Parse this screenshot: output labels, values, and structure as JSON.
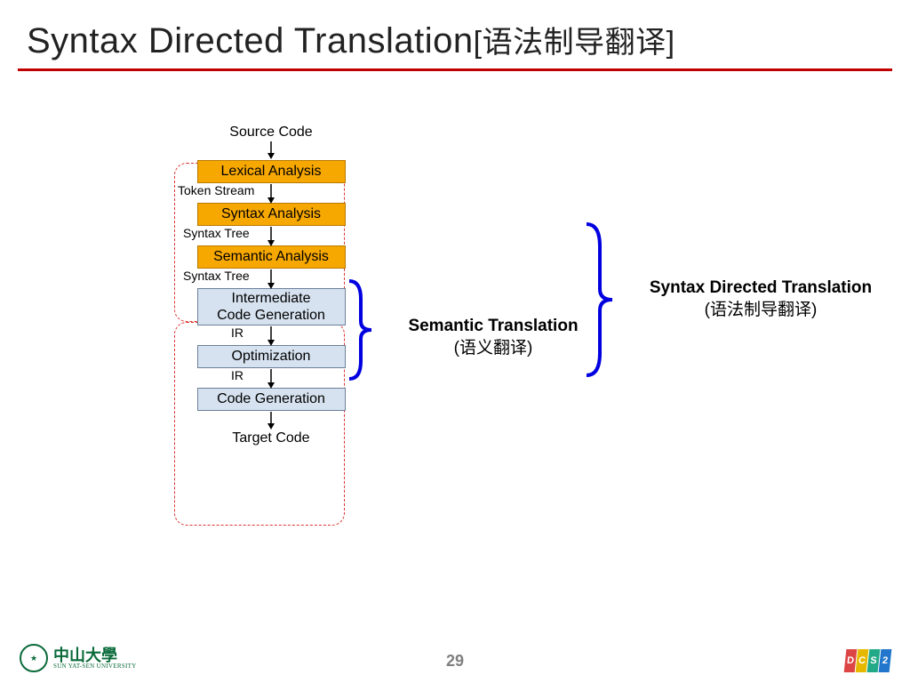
{
  "title_main": "Syntax Directed Translation",
  "title_sub": "[语法制导翻译]",
  "flow": {
    "source": "Source Code",
    "lex": "Lexical Analysis",
    "token": "Token Stream",
    "syn": "Syntax Analysis",
    "tree1": "Syntax Tree",
    "sem": "Semantic Analysis",
    "tree2": "Syntax Tree",
    "icg1": "Intermediate",
    "icg2": "Code Generation",
    "ir1": "IR",
    "opt": "Optimization",
    "ir2": "IR",
    "cg": "Code Generation",
    "target": "Target Code"
  },
  "brace1_title": "Semantic Translation",
  "brace1_sub": "(语义翻译)",
  "brace2_title": "Syntax Directed Translation",
  "brace2_sub": "(语法制导翻译)",
  "page": "29",
  "uni_cn": "中山大學",
  "uni_en": "SUN YAT-SEN UNIVERSITY"
}
